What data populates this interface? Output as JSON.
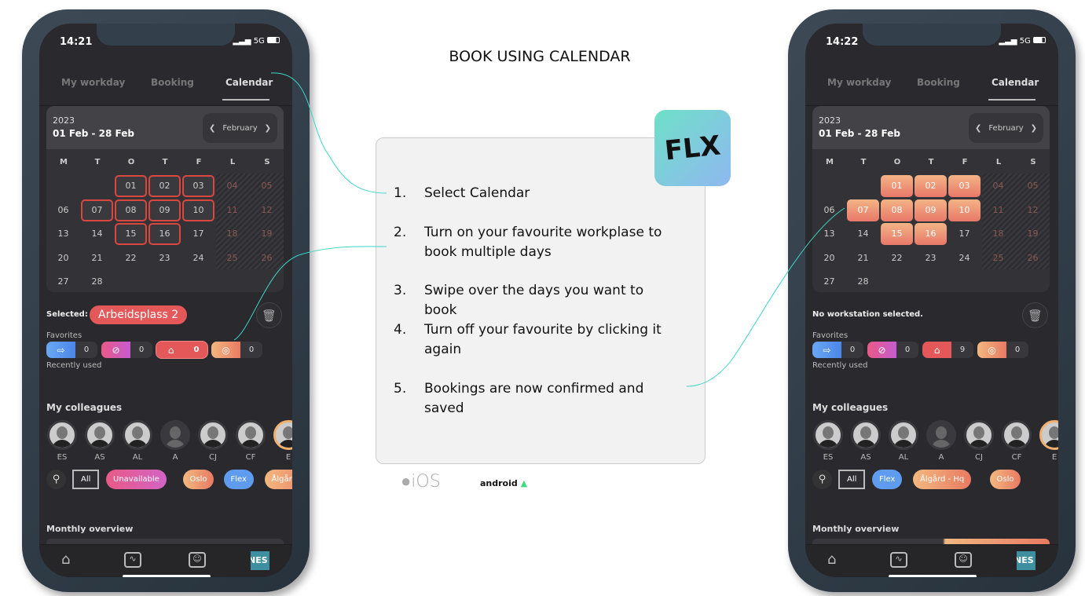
{
  "title": "BOOK USING CALENDAR",
  "logo": "FLX",
  "steps": [
    {
      "num": "1.",
      "text": "Select Calendar"
    },
    {
      "num": "2.",
      "text": "Turn on your favourite workplase to book multiple days"
    },
    {
      "num": "3.",
      "text": "Swipe over the days you want to book"
    },
    {
      "num": "4.",
      "text": "Turn off your favourite by clicking it again"
    },
    {
      "num": "5.",
      "text": "Bookings are now confirmed and saved"
    }
  ],
  "platforms": {
    "ios": "iOS",
    "android": "android"
  },
  "colors": {
    "accent_line": "#3dd6c6",
    "selected_red": "#d9473f",
    "booked_from": "#f3b486",
    "booked_to": "#e8786a"
  },
  "phones": [
    {
      "time": "14:21",
      "network": "5G",
      "tabs": [
        "My workday",
        "Booking",
        "Calendar"
      ],
      "active_tab": 2,
      "year": "2023",
      "range": "01 Feb - 28 Feb",
      "month": "February",
      "weekdays": [
        "M",
        "T",
        "O",
        "T",
        "F",
        "L",
        "S"
      ],
      "weeks": [
        [
          "",
          "",
          "01",
          "02",
          "03",
          "04",
          "05"
        ],
        [
          "06",
          "07",
          "08",
          "09",
          "10",
          "11",
          "12"
        ],
        [
          "13",
          "14",
          "15",
          "16",
          "17",
          "18",
          "19"
        ],
        [
          "20",
          "21",
          "22",
          "23",
          "24",
          "25",
          "26"
        ],
        [
          "27",
          "28",
          "",
          "",
          "",
          "",
          ""
        ]
      ],
      "marked_days": [
        "01",
        "02",
        "03",
        "07",
        "08",
        "09",
        "10",
        "15",
        "16"
      ],
      "mark_style": "outline",
      "selected_label": "Selected:",
      "selected_value": "Arbeidsplass 2",
      "no_selection": "",
      "favorites_label": "Favorites",
      "recent_label": "Recently used",
      "favorites": [
        {
          "icon": "door-exit-icon",
          "count": "0"
        },
        {
          "icon": "ban-icon",
          "count": "0"
        },
        {
          "icon": "building-icon",
          "count": "0",
          "active": true
        },
        {
          "icon": "radar-icon",
          "count": "0"
        }
      ],
      "colleagues_label": "My colleagues",
      "colleagues": [
        "ES",
        "AS",
        "AL",
        "A",
        "CJ",
        "CF",
        "E"
      ],
      "filters": [
        {
          "label": "All",
          "kind": "all"
        },
        {
          "label": "Unavailable",
          "kind": "pink"
        },
        {
          "label": "Oslo",
          "kind": "orange"
        },
        {
          "label": "Flex",
          "kind": "blue"
        },
        {
          "label": "Ålgård - H",
          "kind": "orange"
        }
      ],
      "monthly_label": "Monthly overview",
      "profile_badge": "NES"
    },
    {
      "time": "14:22",
      "network": "5G",
      "tabs": [
        "My workday",
        "Booking",
        "Calendar"
      ],
      "active_tab": 2,
      "year": "2023",
      "range": "01 Feb - 28 Feb",
      "month": "February",
      "weekdays": [
        "M",
        "T",
        "O",
        "T",
        "F",
        "L",
        "S"
      ],
      "weeks": [
        [
          "",
          "",
          "01",
          "02",
          "03",
          "04",
          "05"
        ],
        [
          "06",
          "07",
          "08",
          "09",
          "10",
          "11",
          "12"
        ],
        [
          "13",
          "14",
          "15",
          "16",
          "17",
          "18",
          "19"
        ],
        [
          "20",
          "21",
          "22",
          "23",
          "24",
          "25",
          "26"
        ],
        [
          "27",
          "28",
          "",
          "",
          "",
          "",
          ""
        ]
      ],
      "marked_days": [
        "01",
        "02",
        "03",
        "07",
        "08",
        "09",
        "10",
        "15",
        "16"
      ],
      "mark_style": "filled",
      "selected_label": "",
      "selected_value": "",
      "no_selection": "No workstation selected.",
      "favorites_label": "Favorites",
      "recent_label": "Recently used",
      "favorites": [
        {
          "icon": "door-exit-icon",
          "count": "0"
        },
        {
          "icon": "ban-icon",
          "count": "0"
        },
        {
          "icon": "building-icon",
          "count": "9"
        },
        {
          "icon": "radar-icon",
          "count": "0"
        }
      ],
      "colleagues_label": "My colleagues",
      "colleagues": [
        "ES",
        "AS",
        "AL",
        "A",
        "CJ",
        "CF",
        "E"
      ],
      "filters": [
        {
          "label": "All",
          "kind": "all"
        },
        {
          "label": "Flex",
          "kind": "blue"
        },
        {
          "label": "Ålgård - Hq",
          "kind": "orange"
        },
        {
          "label": "Oslo",
          "kind": "orange"
        }
      ],
      "monthly_label": "Monthly overview",
      "profile_badge": "NES"
    }
  ]
}
